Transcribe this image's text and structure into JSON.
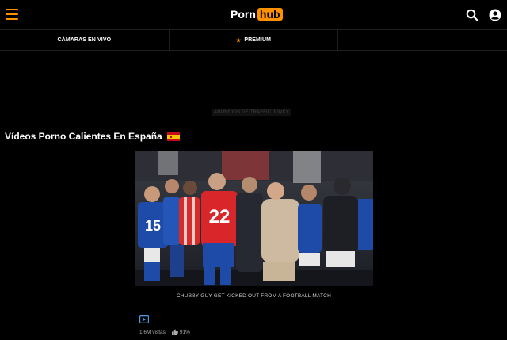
{
  "header": {
    "logo_left": "Porn",
    "logo_right": "hub",
    "accent_color": "#ff9000"
  },
  "nav": {
    "items": [
      {
        "label": "CÁMARAS EN VIVO",
        "icon": null
      },
      {
        "label": "PREMIUM",
        "icon": "star-icon"
      },
      {
        "label": "",
        "icon": null
      }
    ]
  },
  "ad": {
    "label": "ANUNCIOS DE TRAFFIC JUNKY"
  },
  "section": {
    "title": "Vídeos Porno Calientes En España",
    "flag_icon": "spain-flag-icon"
  },
  "video": {
    "title": "CHUBBY GUY GET KICKED OUT FROM A FOOTBALL MATCH",
    "views": "1.6M vistas",
    "rating": "91%",
    "jersey_numbers": [
      "15",
      "22"
    ]
  }
}
